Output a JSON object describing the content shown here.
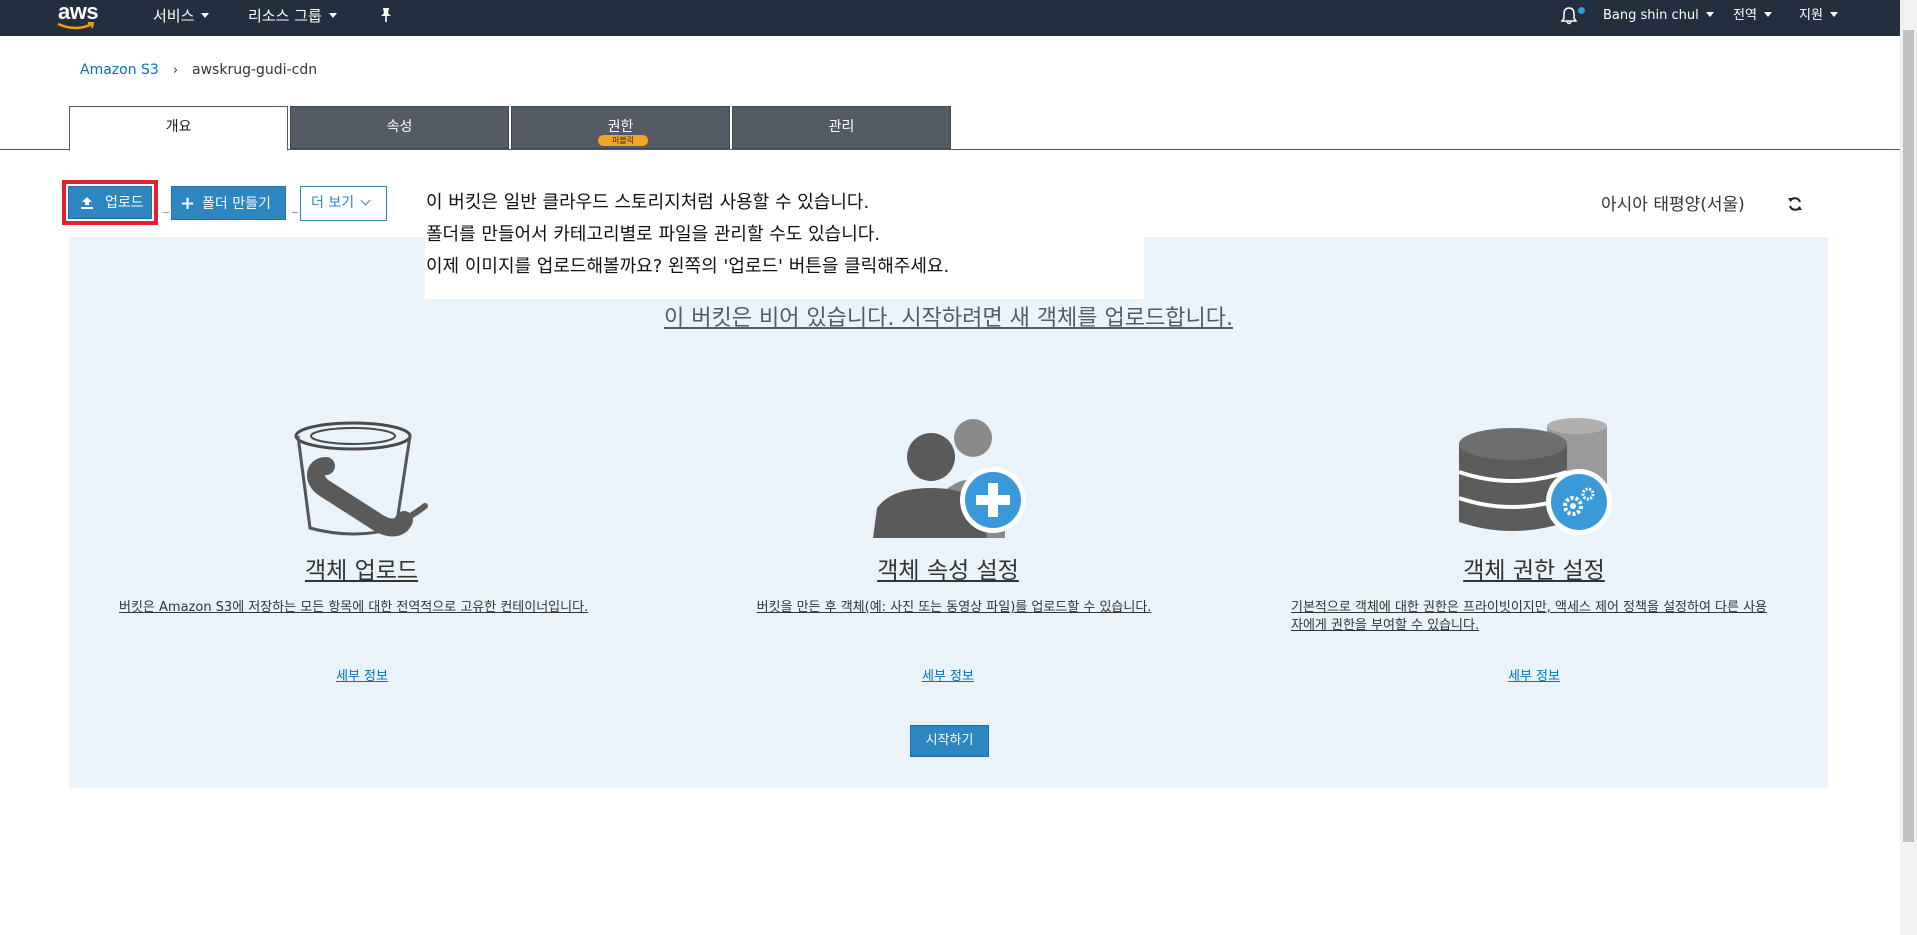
{
  "topnav": {
    "logo": "aws",
    "services_label": "서비스",
    "resource_groups_label": "리소스 그룹",
    "user_label": "Bang shin chul",
    "region_label": "전역",
    "support_label": "지원",
    "icons": [
      "pin-icon",
      "bell-icon"
    ]
  },
  "breadcrumb": {
    "root": "Amazon S3",
    "current": "awskrug-gudi-cdn"
  },
  "tabs": [
    {
      "label": "개요",
      "active": true
    },
    {
      "label": "속성",
      "active": false
    },
    {
      "label": "권한",
      "active": false,
      "badge": "퍼블릭"
    },
    {
      "label": "관리",
      "active": false
    }
  ],
  "toolbar": {
    "upload_label": "업로드",
    "create_folder_label": "폴더 만들기",
    "more_label": "더 보기"
  },
  "region": "아시아 태평양(서울)",
  "tooltip": {
    "line1": "이 버킷은 일반 클라우드 스토리지처럼 사용할 수 있습니다.",
    "line2": "폴더를 만들어서 카테고리별로 파일을 관리할 수도 있습니다.",
    "line3": "이제 이미지를 업로드해볼까요? 왼쪽의 '업로드' 버튼을 클릭해주세요."
  },
  "empty_message": "이 버킷은 비어 있습니다. 시작하려면 새 객체를 업로드합니다.",
  "cards": [
    {
      "title": "객체 업로드",
      "desc": "버킷은 Amazon S3에 저장하는 모든 항목에 대한 전역적으로 고유한 컨테이너입니다.",
      "link": "세부 정보",
      "icon": "bucket-icon"
    },
    {
      "title": "객체 속성 설정",
      "desc": "버킷을 만든 후 객체(예: 사진 또는 동영상 파일)를 업로드할 수 있습니다.",
      "link": "세부 정보",
      "icon": "users-add-icon"
    },
    {
      "title": "객체 권한 설정",
      "desc": "기본적으로 객체에 대한 권한은 프라이빗이지만, 액세스 제어 정책을 설정하여 다른 사용자에게 권한을 부여할 수 있습니다.",
      "link": "세부 정보",
      "icon": "database-settings-icon"
    }
  ],
  "start_button": "시작하기",
  "colors": {
    "nav_bg": "#232f3e",
    "primary": "#2e86c1",
    "panel_bg": "#eaf3fa",
    "highlight": "#e51f2c",
    "badge": "#f2a623"
  }
}
